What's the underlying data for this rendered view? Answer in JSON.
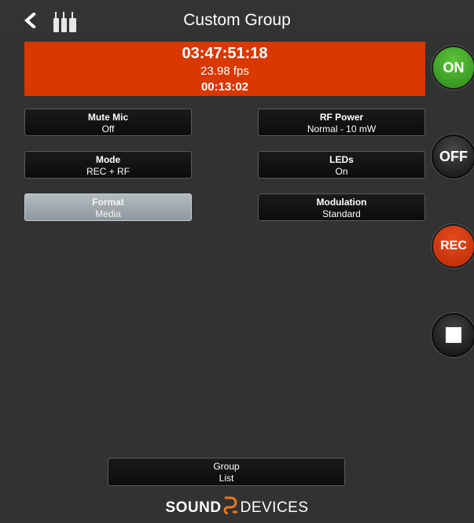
{
  "header": {
    "title": "Custom Group"
  },
  "timecode": {
    "time": "03:47:51:18",
    "fps": "23.98 fps",
    "duration": "00:13:02"
  },
  "buttons": [
    {
      "label": "Mute Mic",
      "value": "Off"
    },
    {
      "label": "RF Power",
      "value": "Normal - 10 mW"
    },
    {
      "label": "Mode",
      "value": "REC + RF"
    },
    {
      "label": "LEDs",
      "value": "On"
    },
    {
      "label": "Format",
      "value": "Media"
    },
    {
      "label": "Modulation",
      "value": "Standard"
    }
  ],
  "side": {
    "on": "ON",
    "off": "OFF",
    "rec": "REC"
  },
  "group_list": {
    "line1": "Group",
    "line2": "List"
  },
  "brand": {
    "part1": "SOUND",
    "part2": "DEVICES"
  },
  "colors": {
    "timecode_bg": "#d93800",
    "on": "#3fa82a",
    "rec": "#d9400f"
  }
}
